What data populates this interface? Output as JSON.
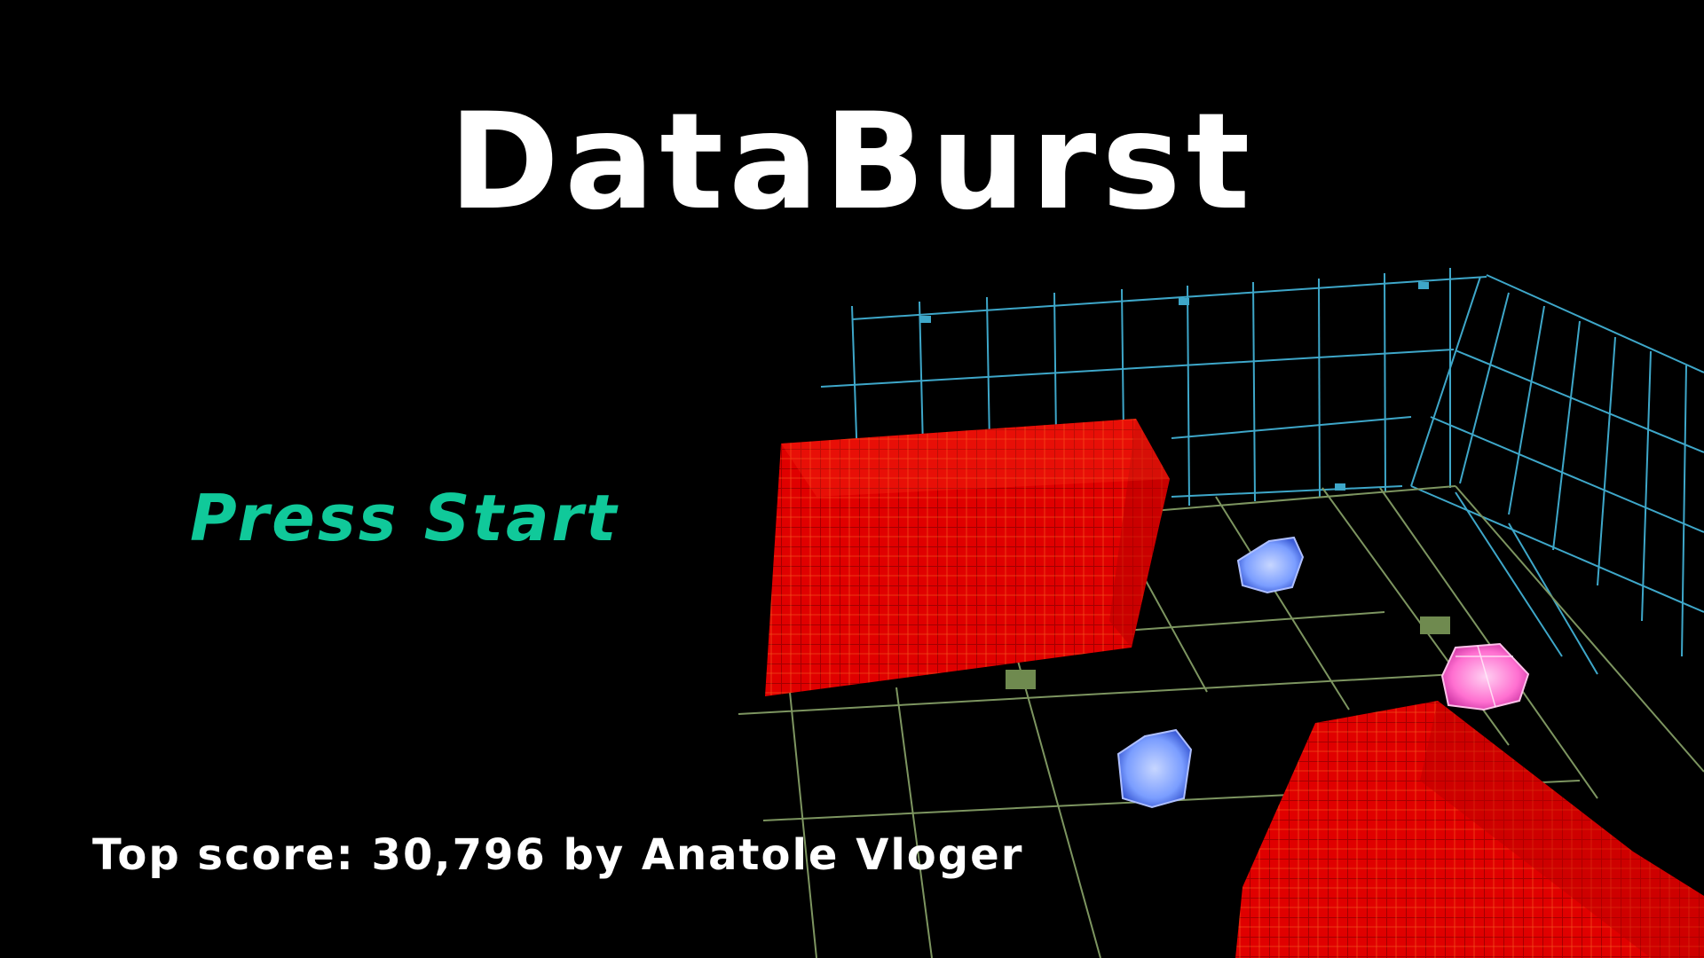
{
  "game": {
    "title": "DataBurst",
    "prompt": "Press Start",
    "top_score_text": "Top score: 30,796 by Anatole Vloger"
  },
  "scene": {
    "objects": [
      "wireframe-wall-grid",
      "floor-grid",
      "red-cube-block",
      "red-cube-block",
      "blue-data-cube",
      "blue-data-cube",
      "pink-data-cube"
    ]
  },
  "colors": {
    "background": "#000000",
    "title": "#ffffff",
    "prompt": "#10c99a",
    "score": "#ffffff",
    "wall_grid": "#3ea7c9",
    "floor_grid": "#7d9560",
    "block": "#e00000",
    "block_line": "#ff8a2a",
    "blue_cube": "#7a9dff",
    "pink_cube": "#ff6fd0"
  }
}
